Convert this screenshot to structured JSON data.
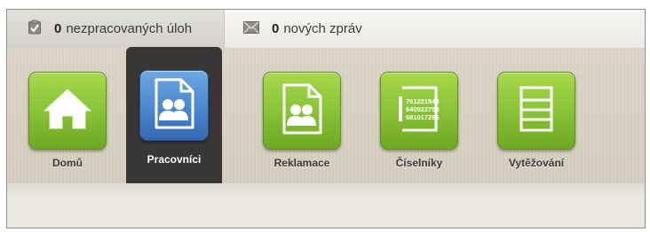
{
  "notifications": {
    "tasks": {
      "count": "0",
      "label": "nezpracovaných úloh",
      "icon": "task-clipboard-icon"
    },
    "messages": {
      "count": "0",
      "label": "nových zpráv",
      "icon": "envelope-icon"
    }
  },
  "menu": {
    "items": [
      {
        "label": "Domů",
        "icon": "home-icon"
      },
      {
        "label": "Pracovníci",
        "icon": "people-document-icon",
        "active": true
      },
      {
        "label": "Reklamace",
        "icon": "people-document-icon"
      },
      {
        "label": "Číselníky",
        "icon": "number-list-icon",
        "numbers": [
          "761221543",
          "640922753",
          "681017286"
        ]
      },
      {
        "label": "Vytěžování",
        "icon": "list-rows-icon"
      }
    ]
  },
  "colors": {
    "tile_green": "#8cc63a",
    "tile_active_blue": "#4b86cf",
    "active_bg": "#393735"
  }
}
